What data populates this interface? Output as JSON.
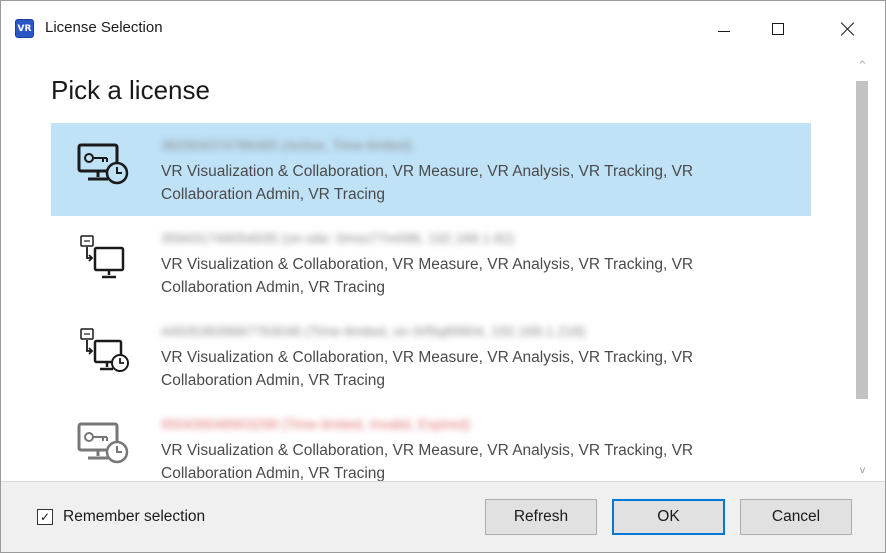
{
  "window": {
    "app_icon_text": "VR",
    "title": "License Selection"
  },
  "main": {
    "heading": "Pick a license",
    "licenses": [
      {
        "id": "382904374786465 (Active, Time-limited)",
        "products": "VR Visualization & Collaboration, VR Measure, VR Analysis, VR Tracking, VR Collaboration Admin, VR Tracing",
        "icon": "license-monitor-clock-icon",
        "selected": true
      },
      {
        "id": "359431749054935 (on-site: 0mss77m098, 192.168.1.82)",
        "products": "VR Visualization & Collaboration, VR Measure, VR Analysis, VR Tracking, VR Collaboration Admin, VR Tracing",
        "icon": "license-transfer-monitor-icon",
        "selected": false
      },
      {
        "id": "449353839667763046 (Time-limited, on 0rf5q89904, 192.168.1.218)",
        "products": "VR Visualization & Collaboration, VR Measure, VR Analysis, VR Tracking, VR Collaboration Admin, VR Tracing",
        "icon": "license-transfer-monitor-clock-icon",
        "selected": false
      },
      {
        "id": "950439048903299 (Time-limited, Invalid, Expired)",
        "products": "VR Visualization & Collaboration, VR Measure, VR Analysis, VR Tracking, VR Collaboration Admin, VR Tracing",
        "icon": "license-monitor-clock-disabled-icon",
        "selected": false
      }
    ]
  },
  "footer": {
    "remember_label": "Remember selection",
    "remember_checked": true,
    "check_glyph": "✓",
    "refresh_label": "Refresh",
    "ok_label": "OK",
    "cancel_label": "Cancel"
  },
  "scrollbar": {
    "up_glyph": "^",
    "down_glyph": "v"
  },
  "colors": {
    "selected_bg": "#bfe2f7",
    "accent": "#0078d7",
    "app_icon": "#2a56c6"
  }
}
